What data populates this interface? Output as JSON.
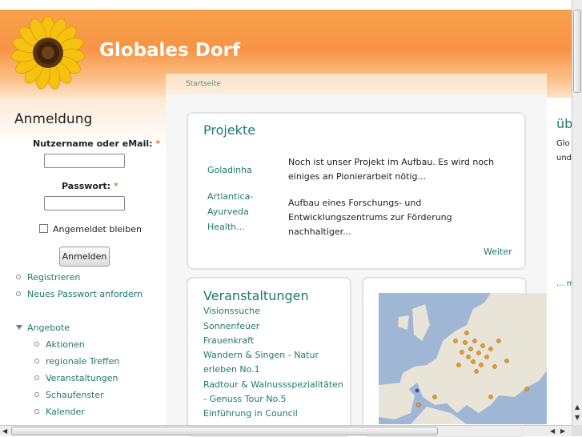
{
  "site": {
    "name": "Globales Dorf"
  },
  "breadcrumb": {
    "home": "Startseite"
  },
  "login": {
    "title": "Anmeldung",
    "username_label": "Nutzername oder eMail:",
    "password_label": "Passwort:",
    "required_mark": "*",
    "remember_label": "Angemeldet bleiben",
    "submit_label": "Anmelden",
    "links": [
      "Registrieren",
      "Neues Passwort anfordern"
    ]
  },
  "nav": {
    "parent": "Angebote",
    "children": [
      "Aktionen",
      "regionale Treffen",
      "Veranstaltungen",
      "Schaufenster",
      "Kalender"
    ]
  },
  "projects": {
    "title": "Projekte",
    "rows": [
      {
        "name": "Goladinha",
        "desc": "Noch ist unser Projekt im Aufbau. Es wird noch einiges an Pionierarbeit nötig..."
      },
      {
        "name": "Artlantica-Ayurveda Health...",
        "desc": "Aufbau eines Forschungs- und Entwicklungszentrums zur Förderung nachhaltiger..."
      }
    ],
    "more": "Weiter"
  },
  "events": {
    "title": "Veranstaltungen",
    "items": [
      "Visionssuche",
      "Sonnenfeuer",
      "Frauenkraft",
      "Wandern & Singen - Natur erleben No.1",
      "Radtour & Walnussspezialitäten - Genuss Tour No.5",
      "Einführung in Council"
    ]
  },
  "right": {
    "title": "üb",
    "line1": "Glo",
    "line2": "und",
    "more": "... m"
  },
  "colors": {
    "accent": "#1e7a68",
    "header": "#f79446",
    "required": "#e07a2c"
  }
}
